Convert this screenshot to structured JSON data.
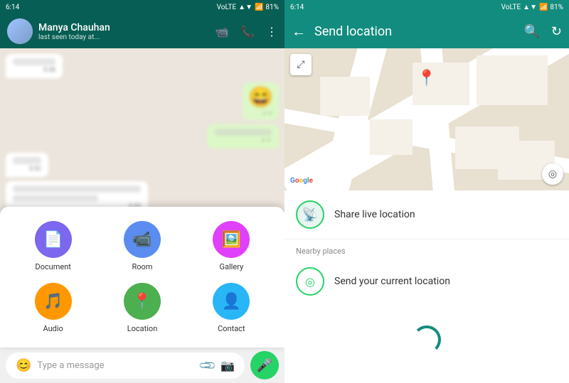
{
  "left_panel": {
    "status_bar": {
      "time": "6:14",
      "battery": "81%"
    },
    "header": {
      "contact_name": "Manya Chauhan",
      "status": "last seen today at..."
    },
    "messages": [
      {
        "type": "received",
        "text": "Ok sure"
      },
      {
        "type": "sent",
        "text": "😄"
      },
      {
        "type": "sent",
        "text": "Hey wait"
      },
      {
        "type": "received",
        "text": "Hey"
      },
      {
        "type": "received",
        "text": "Ok don't worry, wait till 1:30 PM"
      }
    ],
    "input": {
      "placeholder": "Type a message"
    },
    "attachment_menu": {
      "items": [
        {
          "id": "document",
          "label": "Document",
          "icon": "📄",
          "bg_class": "bg-doc"
        },
        {
          "id": "room",
          "label": "Room",
          "icon": "📹",
          "bg_class": "bg-room"
        },
        {
          "id": "gallery",
          "label": "Gallery",
          "icon": "🖼️",
          "bg_class": "bg-gallery"
        },
        {
          "id": "audio",
          "label": "Audio",
          "icon": "🎵",
          "bg_class": "bg-audio"
        },
        {
          "id": "location",
          "label": "Location",
          "icon": "📍",
          "bg_class": "bg-location"
        },
        {
          "id": "contact",
          "label": "Contact",
          "icon": "👤",
          "bg_class": "bg-contact"
        }
      ]
    }
  },
  "right_panel": {
    "status_bar": {
      "time": "6:14",
      "battery": "81%"
    },
    "header": {
      "title": "Send location",
      "back_label": "←",
      "search_icon": "search-icon",
      "refresh_icon": "refresh-icon"
    },
    "map": {
      "google_label": "Google"
    },
    "options": {
      "live_location_label": "Share live location",
      "nearby_section_label": "Nearby places",
      "current_location_label": "Send your current location"
    }
  }
}
